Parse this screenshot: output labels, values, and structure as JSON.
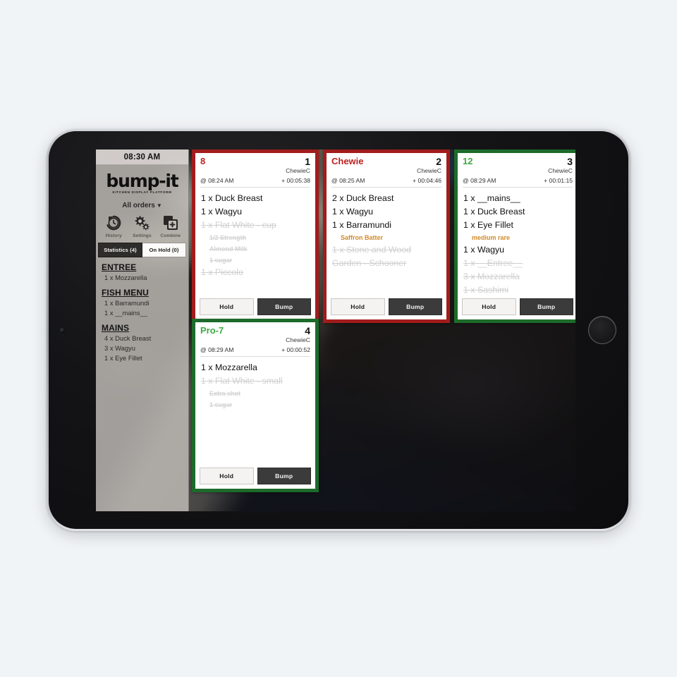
{
  "sidebar": {
    "clock": "08:30 AM",
    "logo_word": "bump-it",
    "logo_sub": "KITCHEN DISPLAY PLATFORM",
    "filter_label": "All orders",
    "filter_caret": "▼",
    "tools": [
      {
        "label": "History",
        "icon": "history-icon"
      },
      {
        "label": "Settings",
        "icon": "gear-icon"
      },
      {
        "label": "Combine",
        "icon": "combine-icon"
      }
    ],
    "tabs": [
      {
        "label": "Statistics (4)",
        "active": true
      },
      {
        "label": "On Hold (0)",
        "active": false
      }
    ],
    "summary": [
      {
        "heading": "ENTREE",
        "lines": [
          "1 x Mozzarella"
        ]
      },
      {
        "heading": "FISH MENU",
        "lines": [
          "1 x Barramundi",
          "1 x __mains__"
        ]
      },
      {
        "heading": "MAINS",
        "lines": [
          "4 x Duck Breast",
          "3 x Wagyu",
          "1 x Eye Fillet"
        ]
      }
    ]
  },
  "orders": [
    {
      "name": "8",
      "number": "1",
      "user": "ChewieC",
      "placed": "@ 08:24 AM",
      "elapsed": "+ 00:05:38",
      "color": "red",
      "items": [
        {
          "text": "1 x Duck Breast",
          "kind": "item",
          "done": false
        },
        {
          "text": "1 x Wagyu",
          "kind": "item",
          "done": false
        },
        {
          "text": "1 x Flat White - cup",
          "kind": "item",
          "done": true
        },
        {
          "text": "1/2 Strength",
          "kind": "sub",
          "done": true
        },
        {
          "text": "Almond Milk",
          "kind": "sub",
          "done": true
        },
        {
          "text": "1 sugar",
          "kind": "sub",
          "done": true
        },
        {
          "text": "1 x Piccolo",
          "kind": "item",
          "done": true
        }
      ],
      "hold_label": "Hold",
      "bump_label": "Bump"
    },
    {
      "name": "Chewie",
      "number": "2",
      "user": "ChewieC",
      "placed": "@ 08:25 AM",
      "elapsed": "+ 00:04:46",
      "color": "red",
      "items": [
        {
          "text": "2 x Duck Breast",
          "kind": "item",
          "done": false
        },
        {
          "text": "1 x Wagyu",
          "kind": "item",
          "done": false
        },
        {
          "text": "1 x Barramundi",
          "kind": "item",
          "done": false
        },
        {
          "text": "Saffron Batter",
          "kind": "mod",
          "done": false
        },
        {
          "text": "1 x Stone and Wood",
          "kind": "item",
          "done": true
        },
        {
          "text": "Garden - Schooner",
          "kind": "item",
          "done": true
        }
      ],
      "hold_label": "Hold",
      "bump_label": "Bump"
    },
    {
      "name": "12",
      "number": "3",
      "user": "ChewieC",
      "placed": "@ 08:29 AM",
      "elapsed": "+ 00:01:15",
      "color": "green",
      "items": [
        {
          "text": "1 x __mains__",
          "kind": "item",
          "done": false
        },
        {
          "text": "1 x Duck Breast",
          "kind": "item",
          "done": false
        },
        {
          "text": "1 x Eye Fillet",
          "kind": "item",
          "done": false
        },
        {
          "text": "medium rare",
          "kind": "mod",
          "done": false
        },
        {
          "text": "1 x Wagyu",
          "kind": "item",
          "done": false
        },
        {
          "text": "1 x __Entree__",
          "kind": "item",
          "done": true
        },
        {
          "text": "3 x Mozzarella",
          "kind": "item",
          "done": true
        },
        {
          "text": "1 x Sashimi",
          "kind": "item",
          "done": true
        }
      ],
      "hold_label": "Hold",
      "bump_label": "Bump"
    },
    {
      "name": "Pro-7",
      "number": "4",
      "user": "ChewieC",
      "placed": "@ 08:29 AM",
      "elapsed": "+ 00:00:52",
      "color": "green",
      "items": [
        {
          "text": "1 x Mozzarella",
          "kind": "item",
          "done": false
        },
        {
          "text": "1 x Flat White - small",
          "kind": "item",
          "done": true
        },
        {
          "text": "Extra shot",
          "kind": "sub",
          "done": true
        },
        {
          "text": "1 sugar",
          "kind": "sub",
          "done": true
        }
      ],
      "hold_label": "Hold",
      "bump_label": "Bump"
    }
  ],
  "colors": {
    "red_border": "#a21c1c",
    "red_text": "#bf2020",
    "green_border": "#1d6b2a",
    "green_text": "#3aac3f",
    "modifier_orange": "#d08a2a",
    "bump_dark": "#3b3b3b"
  }
}
